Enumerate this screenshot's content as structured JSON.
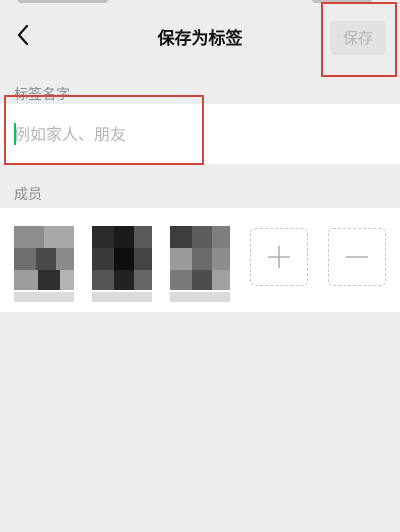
{
  "nav": {
    "title": "保存为标签",
    "save_label": "保存"
  },
  "tag_name": {
    "section_label": "标签名字",
    "placeholder": "例如家人、朋友",
    "value": ""
  },
  "members": {
    "section_label": "成员",
    "items": [
      {
        "name": ""
      },
      {
        "name": ""
      },
      {
        "name": ""
      }
    ],
    "add_icon": "plus-icon",
    "remove_icon": "minus-icon"
  },
  "colors": {
    "background": "#ededed",
    "card": "#ffffff",
    "save_disabled_bg": "#e2e2e2",
    "save_disabled_text": "#b5b5b5",
    "annotation_red": "#d0453a"
  }
}
